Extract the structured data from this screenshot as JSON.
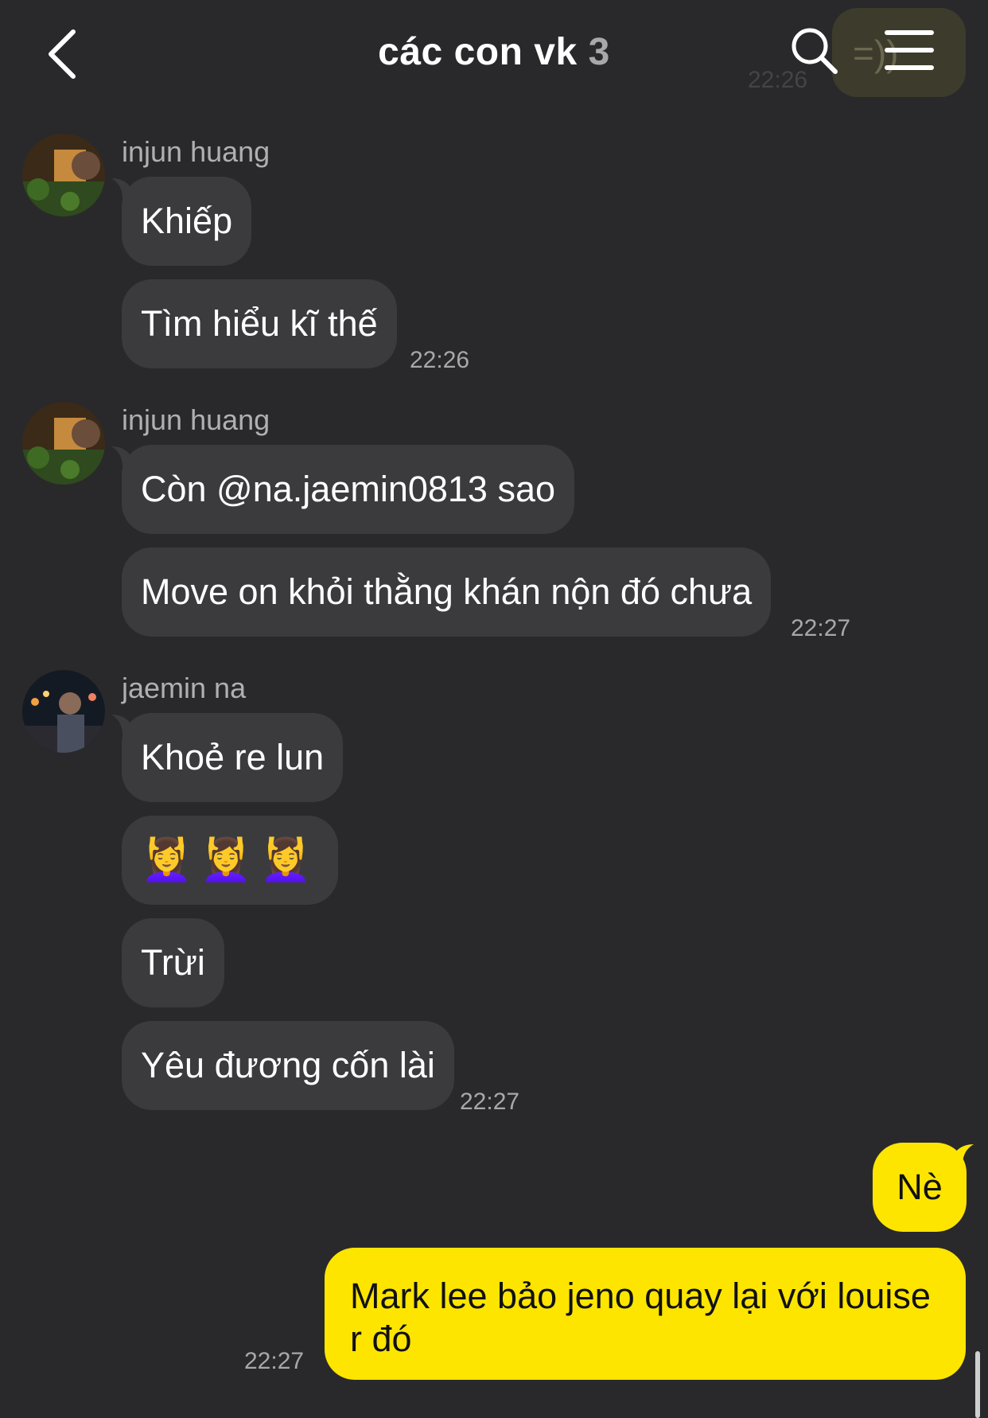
{
  "header": {
    "title": "các con vk",
    "member_count": "3",
    "ghost_bubble_text": "=))",
    "ghost_time": "22:26"
  },
  "icons": {
    "back": "chevron-left-icon",
    "search": "search-icon",
    "menu": "hamburger-menu-icon"
  },
  "messages": {
    "g1": {
      "sender": "injun huang",
      "texts": [
        "Khiếp",
        "Tìm hiểu kĩ thế"
      ],
      "time": "22:26"
    },
    "g2": {
      "sender": "injun huang",
      "texts": [
        "Còn @na.jaemin0813 sao",
        "Move on khỏi thằng khán nộn đó chưa"
      ],
      "time": "22:27"
    },
    "g3": {
      "sender": "jaemin na",
      "texts": [
        "Khoẻ re lun",
        "💆‍♀️💆‍♀️💆‍♀️",
        "Trừi",
        "Yêu đương cốn lài"
      ],
      "time": "22:27"
    },
    "mine": {
      "texts": [
        "Nè",
        "Mark lee bảo jeno quay lại với louise r đó"
      ],
      "time": "22:27"
    }
  },
  "colors": {
    "background": "#29292b",
    "incoming_bubble": "#3b3b3e",
    "outgoing_bubble": "#fde500",
    "secondary_text": "#a8a8aa"
  }
}
